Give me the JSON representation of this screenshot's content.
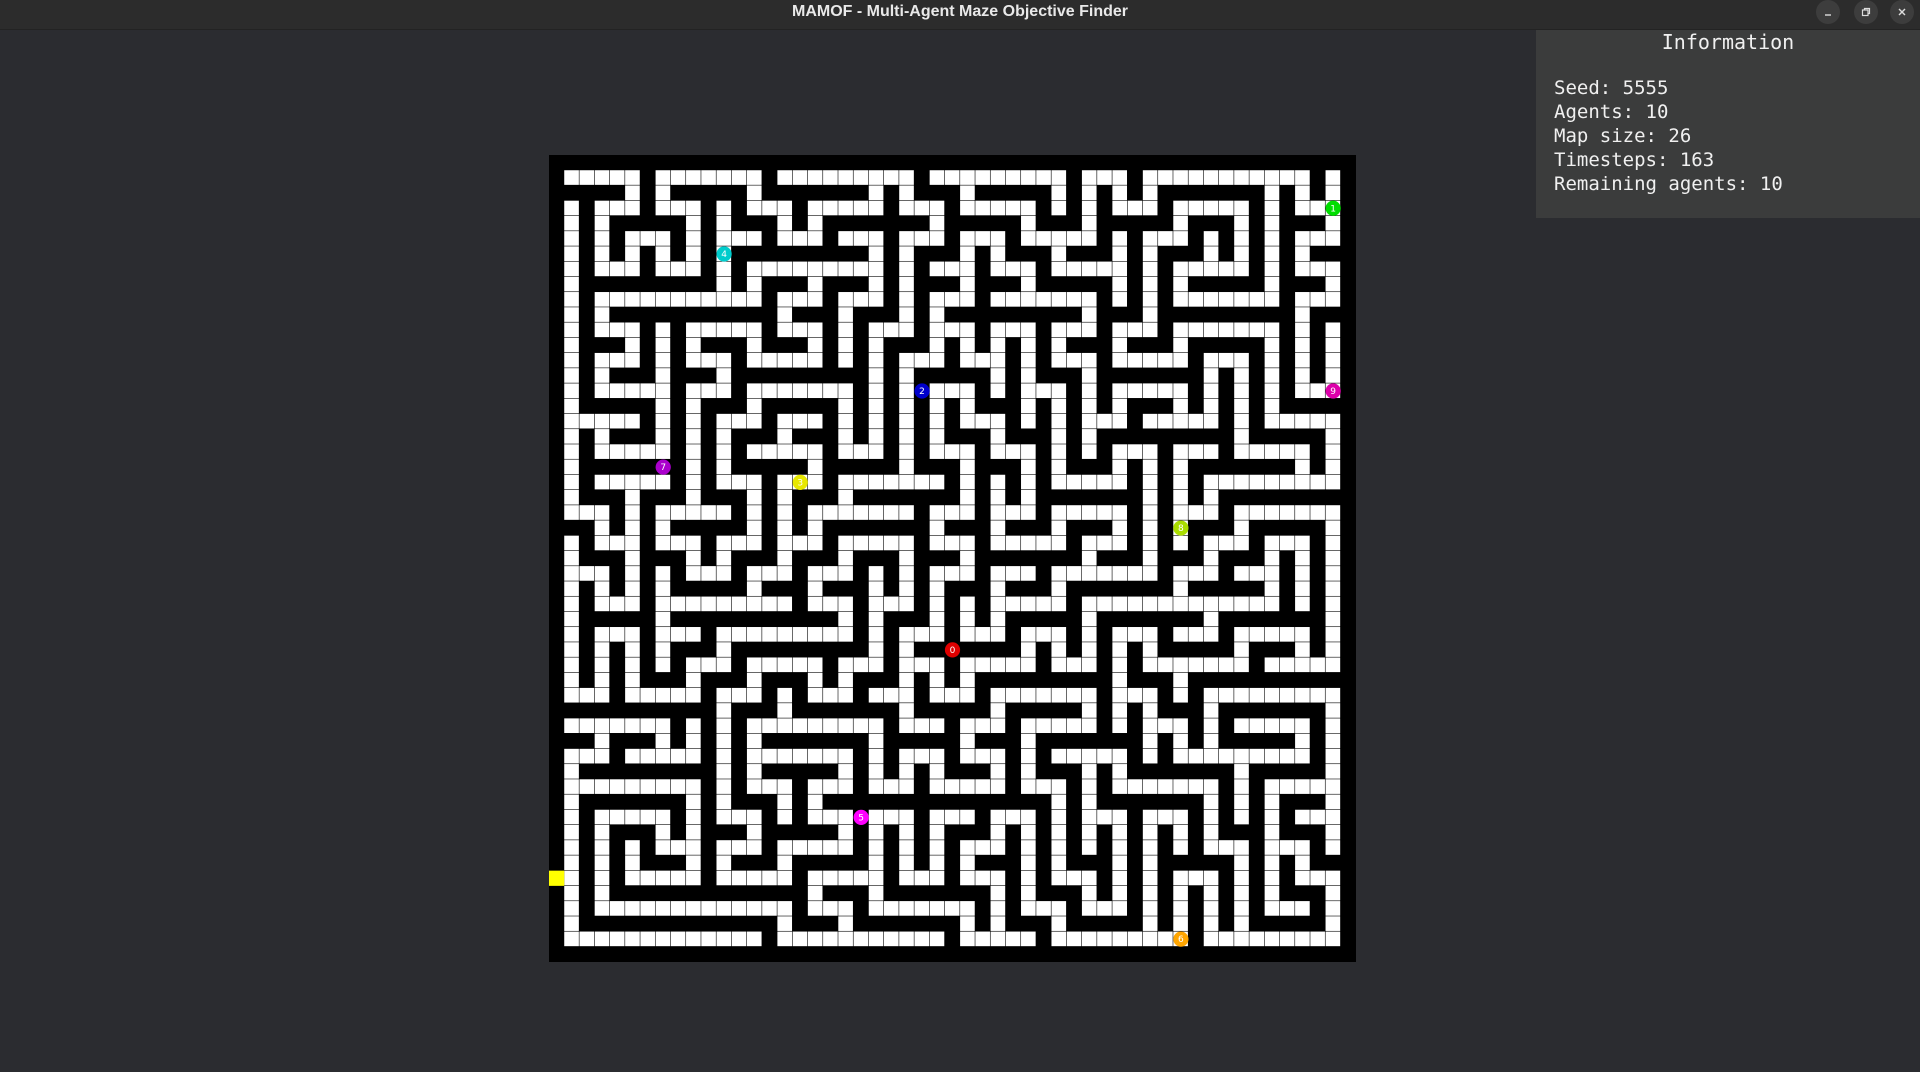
{
  "window": {
    "title": "MAMOF - Multi-Agent Maze Objective Finder",
    "controls": {
      "minimize": "minimize-icon",
      "maximize": "restore-icon",
      "close": "close-icon"
    }
  },
  "info": {
    "title": "Information",
    "rows": [
      {
        "label": "Seed",
        "value": "5555"
      },
      {
        "label": "Agents",
        "value": "10"
      },
      {
        "label": "Map size",
        "value": "26"
      },
      {
        "label": "Timesteps",
        "value": "163"
      },
      {
        "label": "Remaining agents",
        "value": "10"
      }
    ]
  },
  "maze": {
    "map_size": 26,
    "cell_grid": 53,
    "wall_color": "#000000",
    "path_color": "#ffffff",
    "goal": {
      "row": 47,
      "col": 0,
      "color": "#ffff00"
    },
    "agents": [
      {
        "id": "0",
        "row": 32,
        "col": 26,
        "color": "#e00000"
      },
      {
        "id": "1",
        "row": 3,
        "col": 51,
        "color": "#00dd00"
      },
      {
        "id": "2",
        "row": 15,
        "col": 24,
        "color": "#0000cc"
      },
      {
        "id": "3",
        "row": 21,
        "col": 16,
        "color": "#e8e800"
      },
      {
        "id": "4",
        "row": 6,
        "col": 11,
        "color": "#00cccc"
      },
      {
        "id": "5",
        "row": 43,
        "col": 20,
        "color": "#ff00ff"
      },
      {
        "id": "6",
        "row": 51,
        "col": 41,
        "color": "#ffa500"
      },
      {
        "id": "7",
        "row": 20,
        "col": 7,
        "color": "#aa00cc"
      },
      {
        "id": "8",
        "row": 24,
        "col": 41,
        "color": "#aadd00"
      },
      {
        "id": "9",
        "row": 15,
        "col": 51,
        "color": "#dd00aa"
      }
    ]
  }
}
